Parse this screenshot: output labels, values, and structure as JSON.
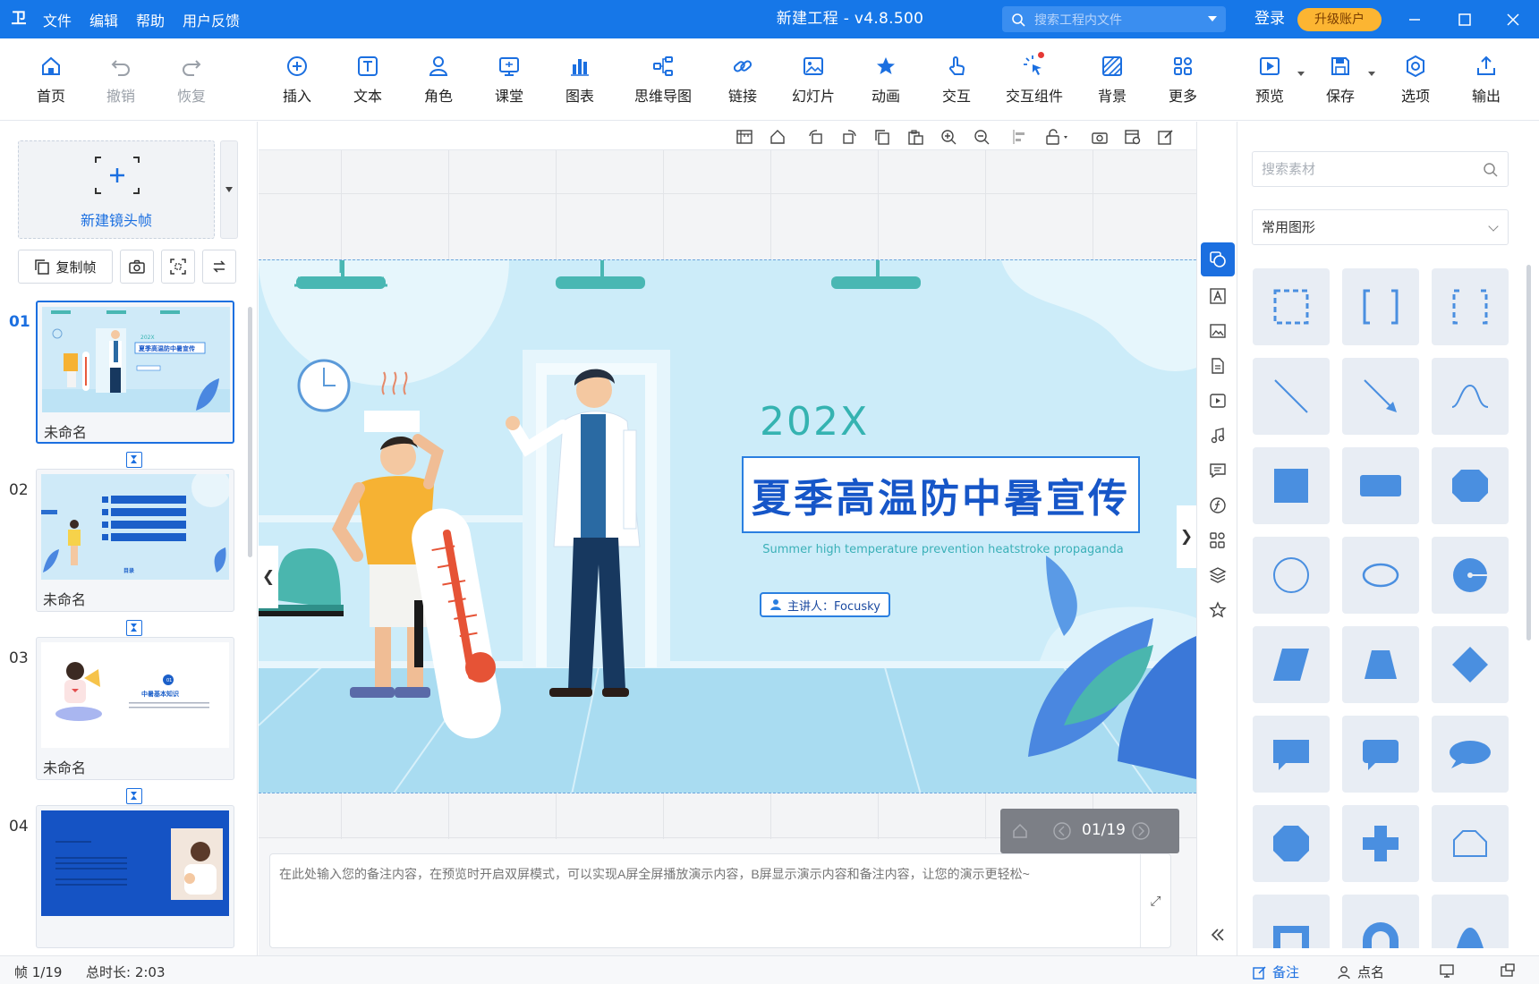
{
  "app": {
    "logo": "卫",
    "title": "新建工程 - v4.8.500"
  },
  "menu": [
    "文件",
    "编辑",
    "帮助",
    "用户反馈"
  ],
  "search_project": {
    "placeholder": "搜索工程内文件"
  },
  "account": {
    "login": "登录",
    "upgrade": "升级账户"
  },
  "toolbar": {
    "home": "首页",
    "undo": "撤销",
    "redo": "恢复",
    "insert": "插入",
    "text": "文本",
    "role": "角色",
    "class": "课堂",
    "chart": "图表",
    "mindmap": "思维导图",
    "link": "链接",
    "slides": "幻灯片",
    "animation": "动画",
    "interaction": "交互",
    "widgets": "交互组件",
    "background": "背景",
    "more": "更多",
    "preview": "预览",
    "save": "保存",
    "options": "选项",
    "export": "输出"
  },
  "left": {
    "new_frame": "新建镜头帧",
    "copy_frame": "复制帧",
    "slides": [
      {
        "num": "01",
        "name": "未命名"
      },
      {
        "num": "02",
        "name": "未命名"
      },
      {
        "num": "03",
        "name": "未命名"
      },
      {
        "num": "04",
        "name": ""
      }
    ],
    "thumb1_title": "夏季高温防中暑宣传",
    "thumb1_year": "202X",
    "thumb2_label": "目录",
    "thumb3_num": "01",
    "thumb3_title": "中暑基本知识"
  },
  "stage": {
    "year": "202X",
    "title": "夏季高温防中暑宣传",
    "subtitle": "Summer high temperature prevention heatstroke propaganda",
    "speaker": "主讲人：Focusky",
    "pager": "01/19"
  },
  "notes": {
    "placeholder": "在此处输入您的备注内容，在预览时开启双屏模式，可以实现A屏全屏播放演示内容，B屏显示演示内容和备注内容，让您的演示更轻松~"
  },
  "resources": {
    "search_placeholder": "搜索素材",
    "category": "常用图形"
  },
  "status": {
    "frame": "帧 1/19",
    "duration": "总时长: 2:03",
    "notes": "备注",
    "rollcall": "点名"
  },
  "colors": {
    "titlebar": "#1677e8",
    "accent": "#1b6fe0",
    "stage_bg": "#ccecf9",
    "shape_fill": "#4a8fe0"
  }
}
